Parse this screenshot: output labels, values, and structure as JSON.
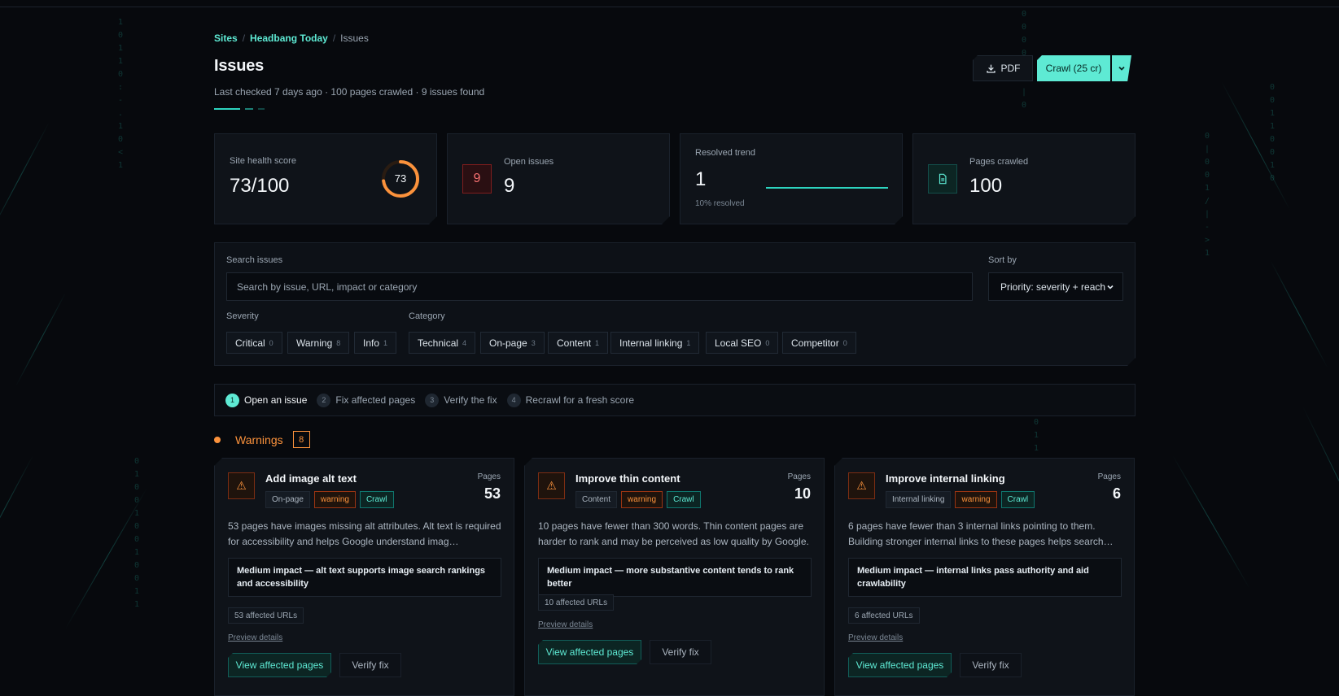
{
  "breadcrumb": {
    "sites": "Sites",
    "site": "Headbang Today",
    "current": "Issues",
    "sep": "/"
  },
  "page": {
    "title": "Issues",
    "subtitle": "Last checked 7 days ago · 100 pages crawled · 9 issues found"
  },
  "header_actions": {
    "pdf_label": "PDF",
    "crawl_label": "Crawl (25 cr)",
    "download_icon": "download-icon",
    "caret_icon": "chevron-down-icon"
  },
  "stats": {
    "health": {
      "label": "Site health score",
      "value": "73/100",
      "ring_value": "73",
      "ring_fraction": 0.73
    },
    "open": {
      "label": "Open issues",
      "value": "9",
      "icon_text": "9"
    },
    "resolved": {
      "label": "Resolved trend",
      "value": "1",
      "sub": "10% resolved"
    },
    "pages": {
      "label": "Pages crawled",
      "value": "100",
      "icon": "document-icon"
    }
  },
  "filters": {
    "search_label": "Search issues",
    "search_placeholder": "Search by issue, URL, impact or category",
    "sort_label": "Sort by",
    "sort_value": "Priority: severity + reach",
    "severity_label": "Severity",
    "category_label": "Category",
    "severity": [
      {
        "label": "Critical",
        "count": "0"
      },
      {
        "label": "Warning",
        "count": "8"
      },
      {
        "label": "Info",
        "count": "1"
      }
    ],
    "category": [
      {
        "label": "Technical",
        "count": "4"
      },
      {
        "label": "On-page",
        "count": "3"
      },
      {
        "label": "Content",
        "count": "1"
      },
      {
        "label": "Internal linking",
        "count": "1"
      },
      {
        "label": "Local SEO",
        "count": "0"
      },
      {
        "label": "Competitor",
        "count": "0"
      }
    ]
  },
  "steps": [
    {
      "num": "1",
      "label": "Open an issue"
    },
    {
      "num": "2",
      "label": "Fix affected pages"
    },
    {
      "num": "3",
      "label": "Verify the fix"
    },
    {
      "num": "4",
      "label": "Recrawl for a fresh score"
    }
  ],
  "section": {
    "title": "Warnings",
    "count": "8"
  },
  "issues": [
    {
      "title": "Add image alt text",
      "category": "On-page",
      "severity": "warning",
      "source": "Crawl",
      "pages_label": "Pages",
      "pages": "53",
      "desc": "53 pages have images missing alt attributes. Alt text is required for accessibility and helps Google understand imag…",
      "impact": "Medium impact — alt text supports image search rankings and accessibility",
      "affected": "53 affected URLs",
      "preview": "Preview details",
      "view": "View affected pages",
      "verify": "Verify fix"
    },
    {
      "title": "Improve thin content",
      "category": "Content",
      "severity": "warning",
      "source": "Crawl",
      "pages_label": "Pages",
      "pages": "10",
      "desc": "10 pages have fewer than 300 words. Thin content pages are harder to rank and may be perceived as low quality by Google.",
      "impact": "Medium impact — more substantive content tends to rank better",
      "affected": "10 affected URLs",
      "preview": "Preview details",
      "view": "View affected pages",
      "verify": "Verify fix"
    },
    {
      "title": "Improve internal linking",
      "category": "Internal linking",
      "severity": "warning",
      "source": "Crawl",
      "pages_label": "Pages",
      "pages": "6",
      "desc": "6 pages have fewer than 3 internal links pointing to them. Building stronger internal links to these pages helps search…",
      "impact": "Medium impact — internal links pass authority and aid crawlability",
      "affected": "6 affected URLs",
      "preview": "Preview details",
      "view": "View affected pages",
      "verify": "Verify fix"
    }
  ],
  "colors": {
    "accent": "#5eead4",
    "warning": "#fb923c",
    "critical": "#f87171",
    "ring": "#fb923c"
  }
}
